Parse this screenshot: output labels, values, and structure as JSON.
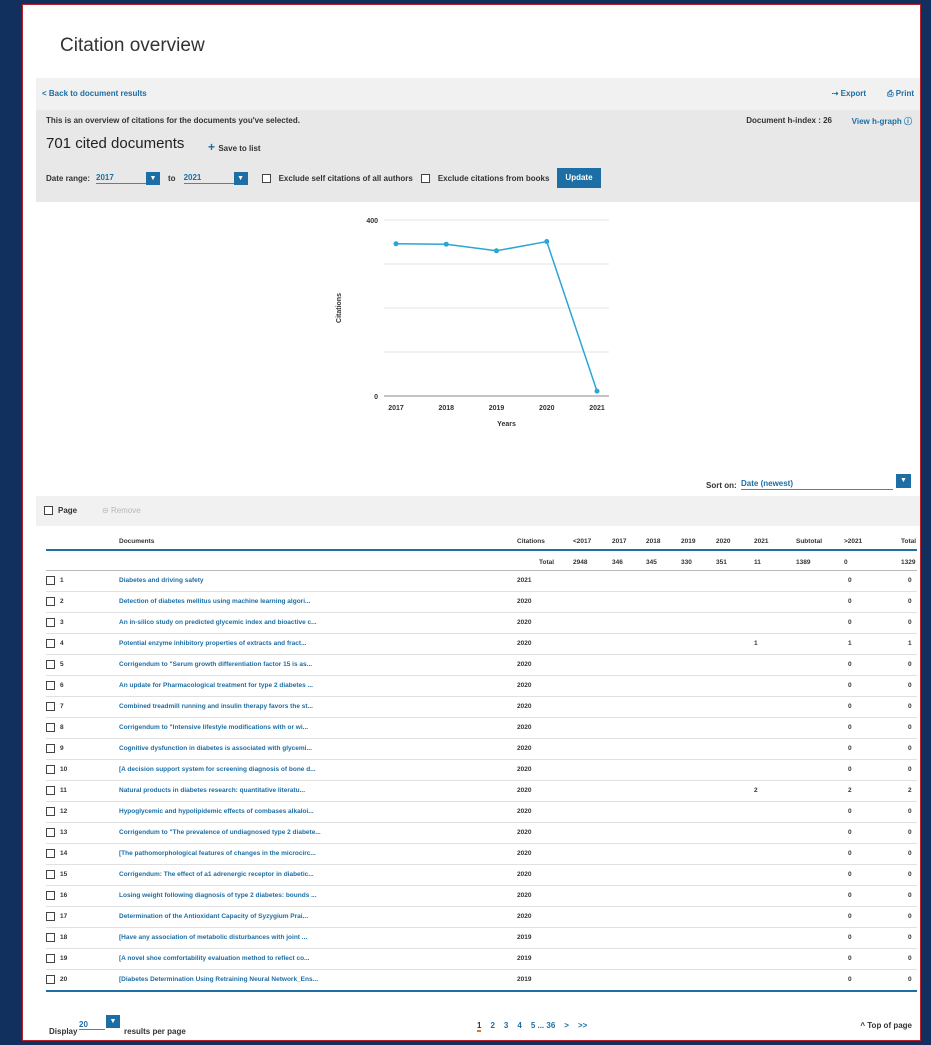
{
  "page": {
    "title": "Citation overview",
    "back_link": "< Back to document results",
    "export": "Export",
    "print": "Print",
    "intro_text": "This is an overview of citations for the documents you've selected.",
    "h_index_label": "Document h-index : 26",
    "view_h_graph": "View h-graph",
    "cited_count": "701 cited documents",
    "save_to_list": "Save to list",
    "date_range_label": "Date range:",
    "date_from": "2017",
    "date_to_label": "to",
    "date_to": "2021",
    "exclude_self": "Exclude self citations of all authors",
    "exclude_books": "Exclude citations from books",
    "update": "Update",
    "sort_on_label": "Sort on:",
    "sort_value": "Date (newest)",
    "page_label": "Page",
    "remove_label": "Remove",
    "display_label": "Display",
    "per_page_value": "20",
    "per_page_suffix": "results per page",
    "pagination": [
      "1",
      "2",
      "3",
      "4",
      "5 ... 36",
      ">",
      ">>"
    ],
    "top_of_page": "Top of page"
  },
  "colors": {
    "accent": "#1c6ea4",
    "frame_border": "#b8202a",
    "background": "#12305e"
  },
  "chart_data": {
    "type": "line",
    "x": [
      "2017",
      "2018",
      "2019",
      "2020",
      "2021"
    ],
    "series": [
      {
        "values": [
          346,
          345,
          330,
          351,
          11
        ]
      }
    ],
    "ylabel": "Citations",
    "xlabel": "Years",
    "ylim": [
      0,
      400
    ],
    "yticks": [
      "0",
      "400"
    ],
    "grid": true
  },
  "table": {
    "headers": [
      "Documents",
      "Citations",
      "<2017",
      "2017",
      "2018",
      "2019",
      "2020",
      "2021",
      "Subtotal",
      ">2021",
      "Total"
    ],
    "total_row": [
      "Total",
      "2948",
      "346",
      "345",
      "330",
      "351",
      "11",
      "1389",
      "0",
      "1329"
    ],
    "rows": [
      {
        "idx": "1",
        "doc": "Diabetes and driving safety",
        "year": "2021",
        "c2020": "",
        "subtotal": "0",
        "total": "0"
      },
      {
        "idx": "2",
        "doc": "Detection of diabetes mellitus using machine learning algori...",
        "year": "2020",
        "c2020": "",
        "subtotal": "0",
        "total": "0"
      },
      {
        "idx": "3",
        "doc": "An in-silico study on predicted glycemic index and bioactive c...",
        "year": "2020",
        "c2020": "",
        "subtotal": "0",
        "total": "0"
      },
      {
        "idx": "4",
        "doc": "Potential enzyme inhibitory properties of extracts and fract...",
        "year": "2020",
        "c2020": "1",
        "subtotal": "1",
        "total": "1"
      },
      {
        "idx": "5",
        "doc": "Corrigendum to \"Serum growth differentiation factor 15 is as...",
        "year": "2020",
        "c2020": "",
        "subtotal": "0",
        "total": "0"
      },
      {
        "idx": "6",
        "doc": "An update for Pharmacological treatment for type 2 diabetes ...",
        "year": "2020",
        "c2020": "",
        "subtotal": "0",
        "total": "0"
      },
      {
        "idx": "7",
        "doc": "Combined treadmill running and insulin therapy favors the st...",
        "year": "2020",
        "c2020": "",
        "subtotal": "0",
        "total": "0"
      },
      {
        "idx": "8",
        "doc": "Corrigendum to \"Intensive lifestyle modifications with or wi...",
        "year": "2020",
        "c2020": "",
        "subtotal": "0",
        "total": "0"
      },
      {
        "idx": "9",
        "doc": "Cognitive dysfunction in diabetes is associated with glycemi...",
        "year": "2020",
        "c2020": "",
        "subtotal": "0",
        "total": "0"
      },
      {
        "idx": "10",
        "doc": "[A decision support system for screening diagnosis of bone d...",
        "year": "2020",
        "c2020": "",
        "subtotal": "0",
        "total": "0"
      },
      {
        "idx": "11",
        "doc": "Natural products in diabetes research: quantitative literatu...",
        "year": "2020",
        "c2020": "2",
        "subtotal": "2",
        "total": "2"
      },
      {
        "idx": "12",
        "doc": "Hypoglycemic and hypolipidemic effects of combases alkaloi...",
        "year": "2020",
        "c2020": "",
        "subtotal": "0",
        "total": "0"
      },
      {
        "idx": "13",
        "doc": "Corrigendum to \"The prevalence of undiagnosed type 2 diabete...",
        "year": "2020",
        "c2020": "",
        "subtotal": "0",
        "total": "0"
      },
      {
        "idx": "14",
        "doc": "[The pathomorphological features of changes in the microcirc...",
        "year": "2020",
        "c2020": "",
        "subtotal": "0",
        "total": "0"
      },
      {
        "idx": "15",
        "doc": "Corrigendum: The effect of a1 adrenergic receptor in diabetic...",
        "year": "2020",
        "c2020": "",
        "subtotal": "0",
        "total": "0"
      },
      {
        "idx": "16",
        "doc": "Losing weight following diagnosis of type 2 diabetes: bounds ...",
        "year": "2020",
        "c2020": "",
        "subtotal": "0",
        "total": "0"
      },
      {
        "idx": "17",
        "doc": "Determination of the Antioxidant Capacity of Syzygium Prai...",
        "year": "2020",
        "c2020": "",
        "subtotal": "0",
        "total": "0"
      },
      {
        "idx": "18",
        "doc": "[Have any association of metabolic disturbances with joint ...",
        "year": "2019",
        "c2020": "",
        "subtotal": "0",
        "total": "0"
      },
      {
        "idx": "19",
        "doc": "[A novel shoe comfortability evaluation method to reflect co...",
        "year": "2019",
        "c2020": "",
        "subtotal": "0",
        "total": "0"
      },
      {
        "idx": "20",
        "doc": "[Diabetes Determination Using Retraining Neural Network_Ens...",
        "year": "2019",
        "c2020": "",
        "subtotal": "0",
        "total": "0"
      }
    ]
  }
}
